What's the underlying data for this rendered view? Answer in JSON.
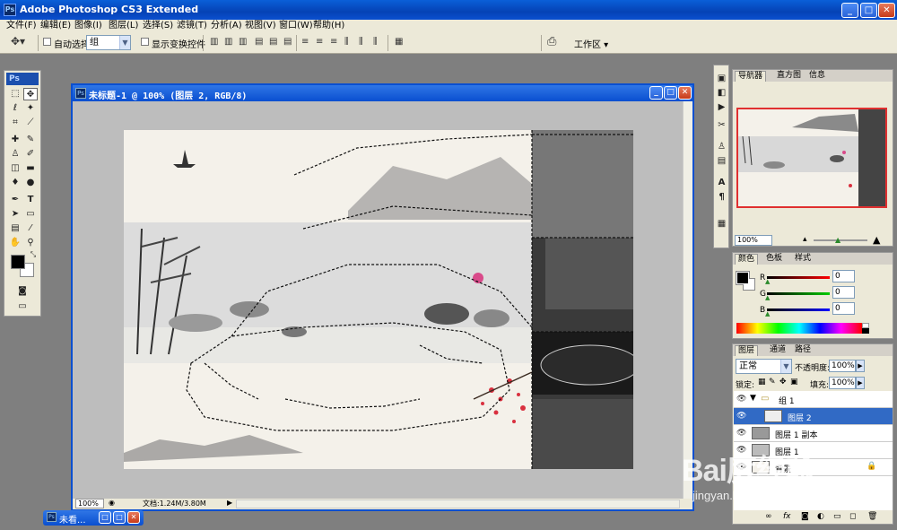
{
  "app": {
    "title": "Adobe Photoshop CS3 Extended",
    "logo": "Ps"
  },
  "window_buttons": {
    "minimize": "_",
    "maximize": "□",
    "close": "✕"
  },
  "menu": [
    "文件(F)",
    "编辑(E)",
    "图像(I)",
    "图层(L)",
    "选择(S)",
    "滤镜(T)",
    "分析(A)",
    "视图(V)",
    "窗口(W)",
    "帮助(H)"
  ],
  "options": {
    "auto_select_label": "自动选择:",
    "auto_select_value": "组",
    "show_transform_label": "显示变换控件",
    "workspace_label": "工作区 ▾"
  },
  "toolbox": {
    "logo": "Ps"
  },
  "document": {
    "title": "未标题-1 @ 100% (图层 2, RGB/8)",
    "zoom": "100%",
    "doc_info": "文档:1.24M/3.80M",
    "minimized_title": "未看..."
  },
  "navigator": {
    "tabs": [
      "导航器",
      "直方图",
      "信息"
    ],
    "zoom": "100%"
  },
  "color_panel": {
    "tabs": [
      "颜色",
      "色板",
      "样式"
    ],
    "r_label": "R",
    "g_label": "G",
    "b_label": "B",
    "r": "0",
    "g": "0",
    "b": "0",
    "colors": {
      "foreground": "#000000",
      "background": "#ffffff"
    }
  },
  "layers": {
    "tabs": [
      "图层",
      "通道",
      "路径"
    ],
    "blend_mode": "正常",
    "opacity_label": "不透明度:",
    "opacity": "100%",
    "lock_label": "锁定:",
    "fill_label": "填充:",
    "fill": "100%",
    "rows": [
      "组 1",
      "图层 2",
      "图层 1 副本",
      "图层 1",
      "背景"
    ]
  },
  "watermark": {
    "main": "Bai度经验",
    "sub": "jingyan.baidu.com"
  }
}
